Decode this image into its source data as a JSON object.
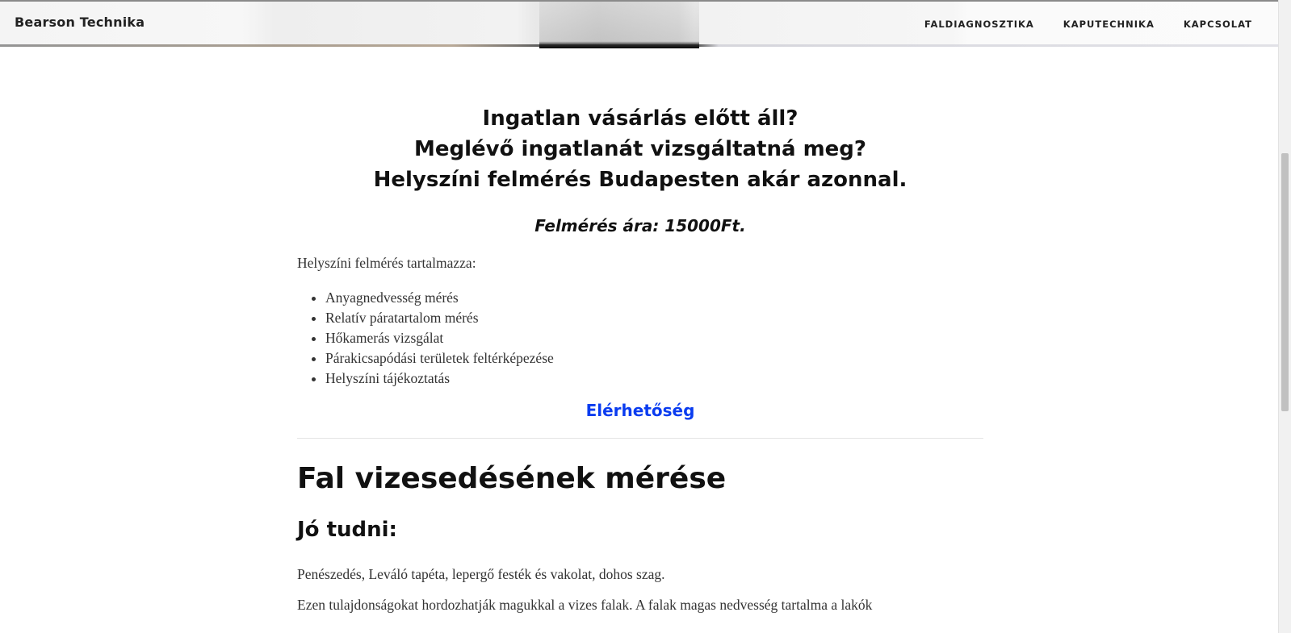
{
  "navbar": {
    "brand": "Bearson Technika",
    "links": [
      {
        "label": "FALDIAGNOSZTIKA"
      },
      {
        "label": "KAPUTECHNIKA"
      },
      {
        "label": "KAPCSOLAT"
      }
    ]
  },
  "intro": {
    "heading_lines": [
      "Ingatlan vásárlás előtt áll?",
      "Meglévő ingatlanát vizsgáltatná meg?",
      "Helyszíni felmérés Budapesten akár azonnal."
    ],
    "price": "Felmérés ára: 15000Ft.",
    "includes_label": "Helyszíni felmérés tartalmazza:",
    "services": [
      "Anyagnedvesség mérés",
      "Relatív páratartalom mérés",
      "Hőkamerás vizsgálat",
      "Párakicsapódási területek feltérképezése",
      "Helyszíni tájékoztatás"
    ],
    "contact_link": "Elérhetőség"
  },
  "section": {
    "title": "Fal vizesedésének mérése",
    "subtitle": "Jó tudni:",
    "paragraphs": [
      "Penészedés, Leváló tapéta, lepergő festék és vakolat, dohos szag.",
      "Ezen tulajdonságokat hordozhatják magukkal a vizes falak. A falak magas nedvesség tartalma a lakók"
    ]
  },
  "colors": {
    "link": "#0a3cf0",
    "heading": "#111111",
    "body_text": "#333333"
  }
}
